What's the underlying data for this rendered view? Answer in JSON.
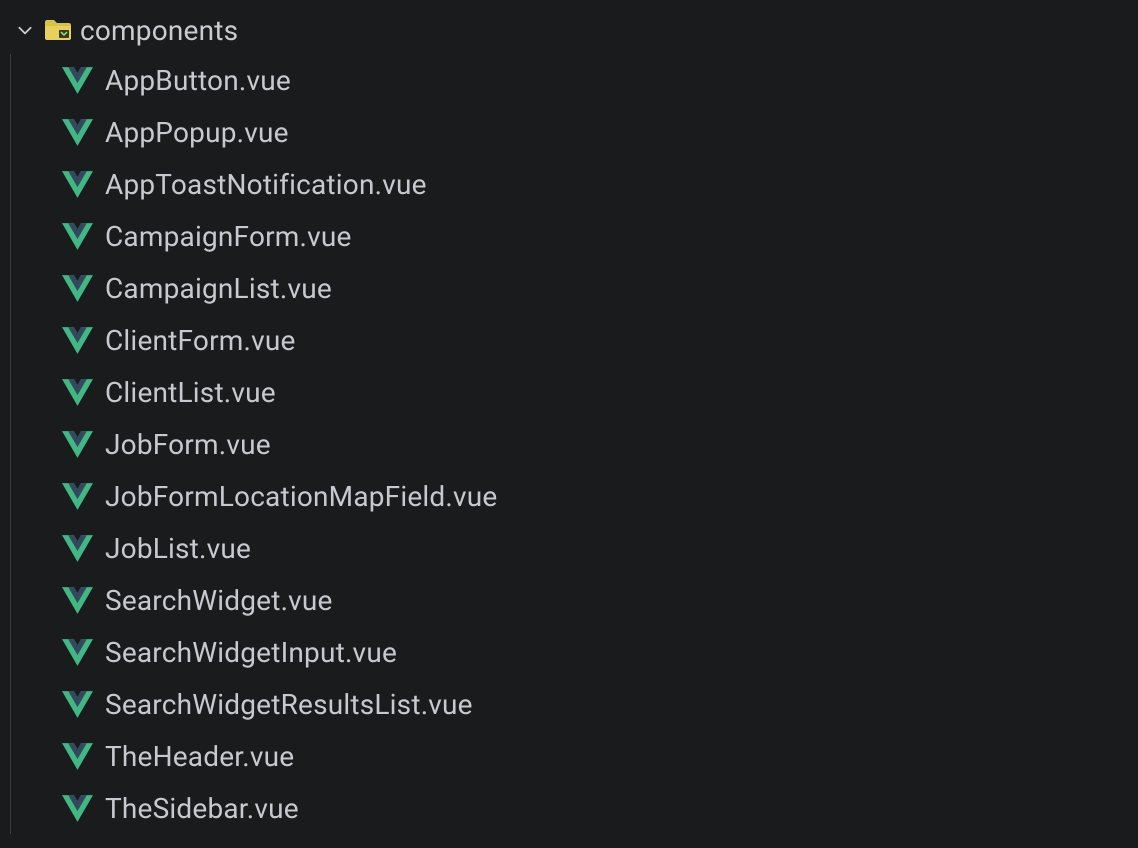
{
  "folder": {
    "name": "components",
    "expanded": true
  },
  "files": [
    {
      "name": "AppButton.vue",
      "type": "vue"
    },
    {
      "name": "AppPopup.vue",
      "type": "vue"
    },
    {
      "name": "AppToastNotification.vue",
      "type": "vue"
    },
    {
      "name": "CampaignForm.vue",
      "type": "vue"
    },
    {
      "name": "CampaignList.vue",
      "type": "vue"
    },
    {
      "name": "ClientForm.vue",
      "type": "vue"
    },
    {
      "name": "ClientList.vue",
      "type": "vue"
    },
    {
      "name": "JobForm.vue",
      "type": "vue"
    },
    {
      "name": "JobFormLocationMapField.vue",
      "type": "vue"
    },
    {
      "name": "JobList.vue",
      "type": "vue"
    },
    {
      "name": "SearchWidget.vue",
      "type": "vue"
    },
    {
      "name": "SearchWidgetInput.vue",
      "type": "vue"
    },
    {
      "name": "SearchWidgetResultsList.vue",
      "type": "vue"
    },
    {
      "name": "TheHeader.vue",
      "type": "vue"
    },
    {
      "name": "TheSidebar.vue",
      "type": "vue"
    }
  ]
}
